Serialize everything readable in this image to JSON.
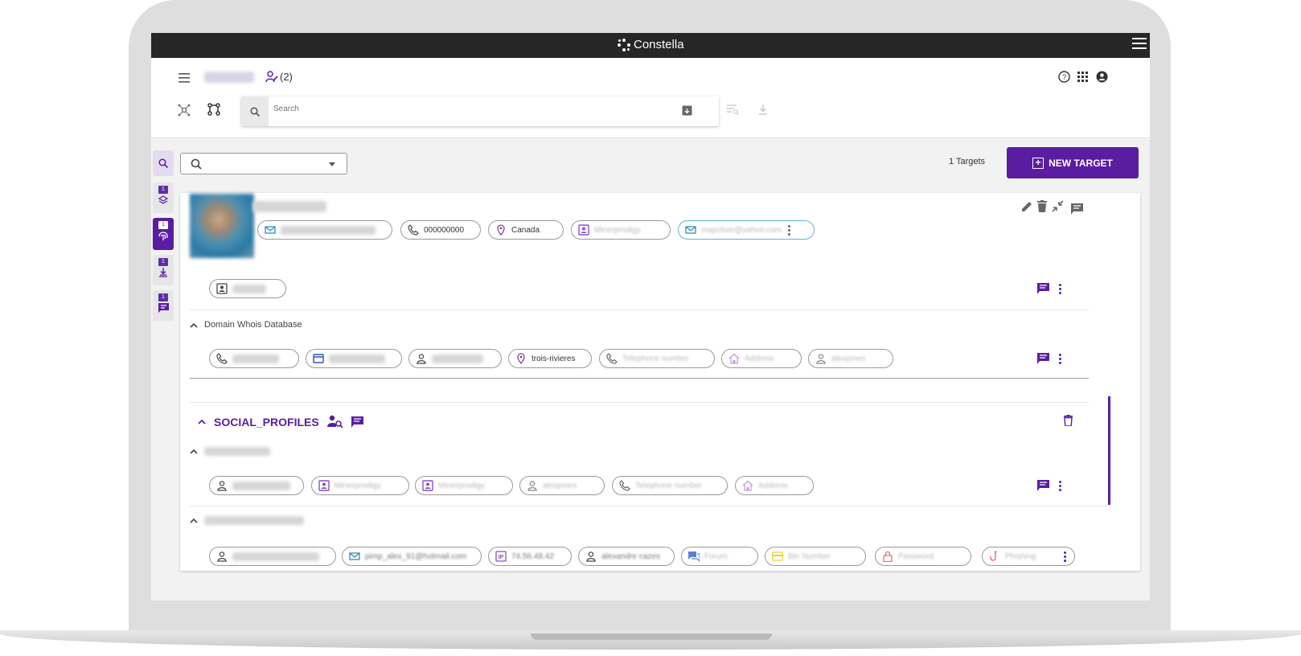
{
  "app": {
    "brand": "Constella"
  },
  "header": {
    "case_count": "(2)",
    "search": {
      "placeholder": "Search"
    }
  },
  "sidebar": {
    "badges": [
      "1",
      "1",
      "1",
      "1"
    ]
  },
  "toolbar": {
    "targets_label": "1 Targets",
    "new_target_label": "NEW TARGET"
  },
  "target": {
    "chips": {
      "phone": "000000000",
      "country": "Canada",
      "username": "Minerprodigy",
      "email": "mapcloor@yahoo.com"
    }
  },
  "sections": {
    "domain_whois": {
      "title": "Domain Whois Database",
      "chips": {
        "city": "trois-rivieres",
        "telephone": "Telephone number",
        "address": "Address",
        "name": "alexjones"
      }
    },
    "social_profiles": {
      "title": "SOCIAL_PROFILES",
      "row1": {
        "username1": "Minerprodigy",
        "username2": "Minerprodigy",
        "name": "alexjones",
        "telephone": "Telephone number",
        "address": "Address"
      },
      "row2": {
        "email": "pimp_alex_91@hotmail.com",
        "ip": "74.56.48.42",
        "name": "alexandre cazes",
        "forum": "Forum",
        "bin": "Bin Number",
        "password": "Password",
        "phishing": "Phishing"
      }
    }
  },
  "colors": {
    "accent": "#5a1da2",
    "topbar": "#262626"
  }
}
